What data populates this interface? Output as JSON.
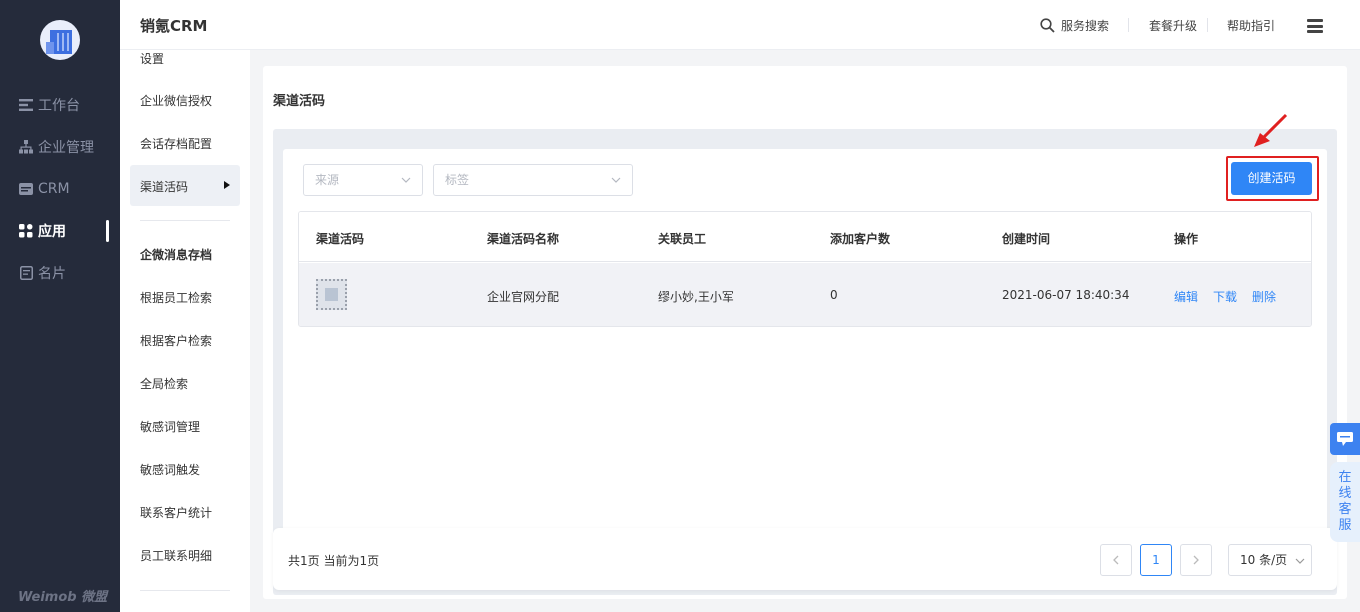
{
  "app": {
    "title": "销氪CRM"
  },
  "leftnav": {
    "items": [
      {
        "label": "工作台",
        "icon": "workbench-icon"
      },
      {
        "label": "企业管理",
        "icon": "org-icon"
      },
      {
        "label": "CRM",
        "icon": "crm-icon"
      },
      {
        "label": "应用",
        "icon": "apps-icon",
        "active": true
      },
      {
        "label": "名片",
        "icon": "card-icon"
      }
    ],
    "brand": "Weimob 微盟"
  },
  "topbar": {
    "search_label": "服务搜索",
    "upgrade_label": "套餐升级",
    "help_label": "帮助指引"
  },
  "subnav": {
    "items_top": [
      "设置",
      "企业微信授权",
      "会话存档配置"
    ],
    "active_item": "渠道活码",
    "section_head": "企微消息存档",
    "items_bottom": [
      "根据员工检索",
      "根据客户检索",
      "全局检索",
      "敏感词管理",
      "敏感词触发",
      "联系客户统计",
      "员工联系明细"
    ]
  },
  "main": {
    "title": "渠道活码",
    "filters": {
      "source_placeholder": "来源",
      "tag_placeholder": "标签"
    },
    "create_button": "创建活码",
    "accent_color": "#2f86f6",
    "highlight_color": "#e02020",
    "table": {
      "headers": [
        "渠道活码",
        "渠道活码名称",
        "关联员工",
        "添加客户数",
        "创建时间",
        "操作"
      ],
      "rows": [
        {
          "name": "企业官网分配",
          "staff": "缪小妙,王小军",
          "customers": "0",
          "created": "2021-06-07 18:40:34",
          "actions": [
            "编辑",
            "下载",
            "删除"
          ]
        }
      ]
    },
    "pagination": {
      "summary": "共1页 当前为1页",
      "current": "1",
      "page_size": "10 条/页"
    }
  },
  "float": {
    "service_label": "在线客服"
  }
}
